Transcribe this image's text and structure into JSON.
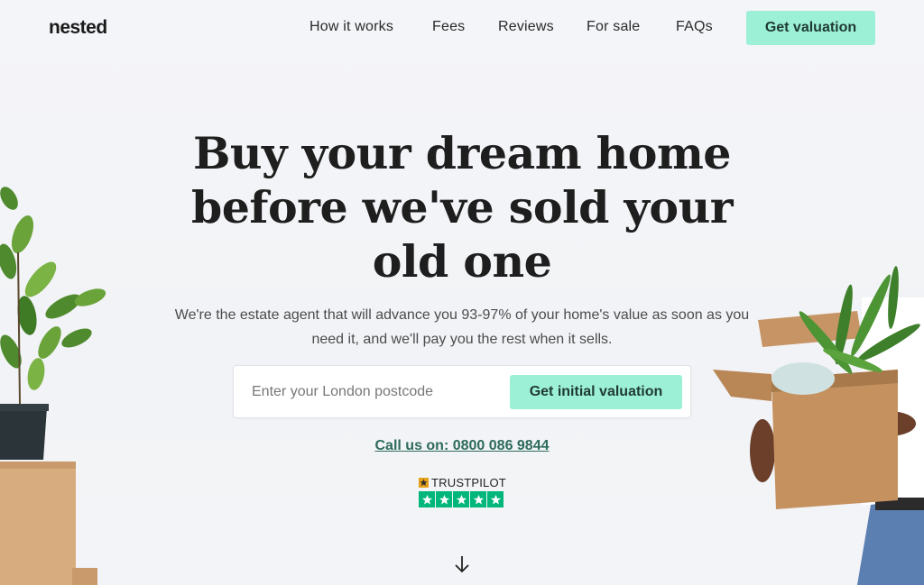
{
  "nav": {
    "logo": "nested",
    "links": [
      "How it works",
      "Fees",
      "Reviews",
      "For sale",
      "FAQs"
    ],
    "cta": "Get valuation"
  },
  "hero": {
    "headline": "Buy your dream home before we've sold your old one",
    "subheading": "We're the estate agent that will advance you 93-97% of your home's value as soon as you need it, and we'll pay you the rest when it sells.",
    "postcode_placeholder": "Enter your London postcode",
    "valuation_button": "Get initial valuation",
    "call_text": "Call us on: 0800 086 9844"
  },
  "trustpilot": {
    "label": "TRUSTPILOT",
    "rating_stars": 5
  },
  "icons": {
    "scroll_arrow": "arrow-down-icon",
    "trustpilot_star": "star-icon"
  },
  "colors": {
    "accent": "#9cf0d6",
    "link": "#2d6b5c",
    "trustpilot_green": "#00b67a"
  }
}
